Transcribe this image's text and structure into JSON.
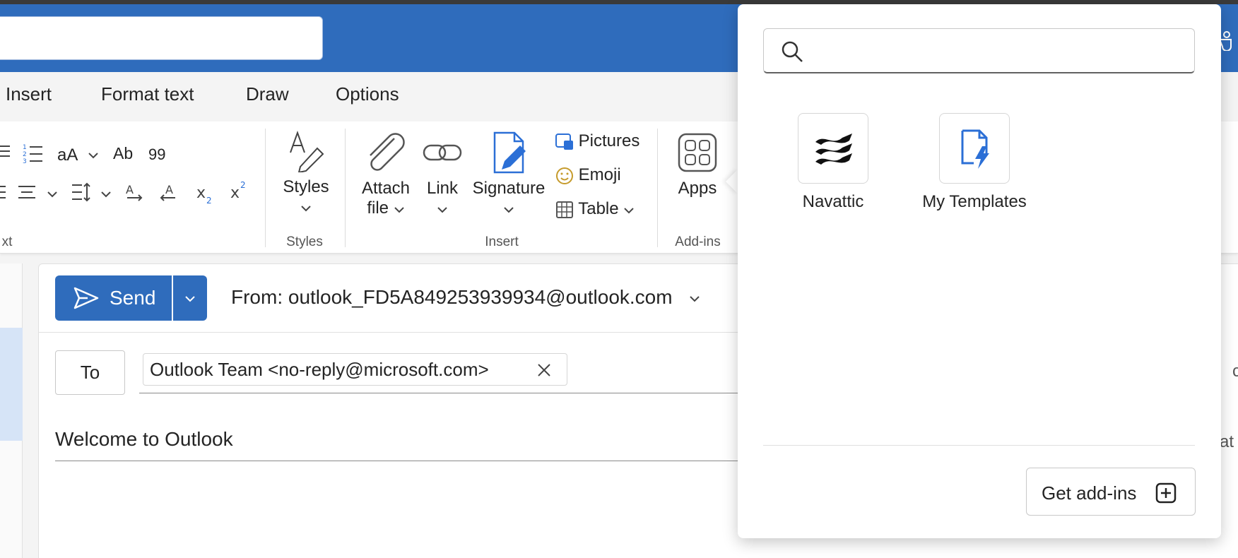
{
  "tabs": [
    {
      "label": "Insert"
    },
    {
      "label": "Format text"
    },
    {
      "label": "Draw"
    },
    {
      "label": "Options"
    }
  ],
  "ribbon": {
    "text_group_label": "xt",
    "styles_label": "Styles",
    "styles_group_label": "Styles",
    "attach_label_1": "Attach",
    "attach_label_2": "file",
    "link_label": "Link",
    "signature_label": "Signature",
    "pictures_label": "Pictures",
    "emoji_label": "Emoji",
    "table_label": "Table",
    "insert_group_label": "Insert",
    "apps_label": "Apps",
    "addins_group_label": "Add-ins",
    "font_size_glyph": "aA",
    "spell_glyph": "Ab",
    "quote_glyph": "99"
  },
  "compose": {
    "send_label": "Send",
    "from_text": "From: outlook_FD5A849253939934@outlook.com",
    "to_label": "To",
    "recipient": "Outlook Team <no-reply@microsoft.com>",
    "subject": "Welcome to Outlook",
    "right_peek_1": "c",
    "right_peek_2": "at"
  },
  "popup": {
    "search_placeholder": "",
    "addins": [
      {
        "name": "Navattic"
      },
      {
        "name": "My Templates"
      }
    ],
    "get_addins_label": "Get add-ins"
  },
  "colors": {
    "brand_blue": "#2f6cbc",
    "accent_icon_blue": "#2b6fd6",
    "emoji_gold": "#c69b2c"
  }
}
